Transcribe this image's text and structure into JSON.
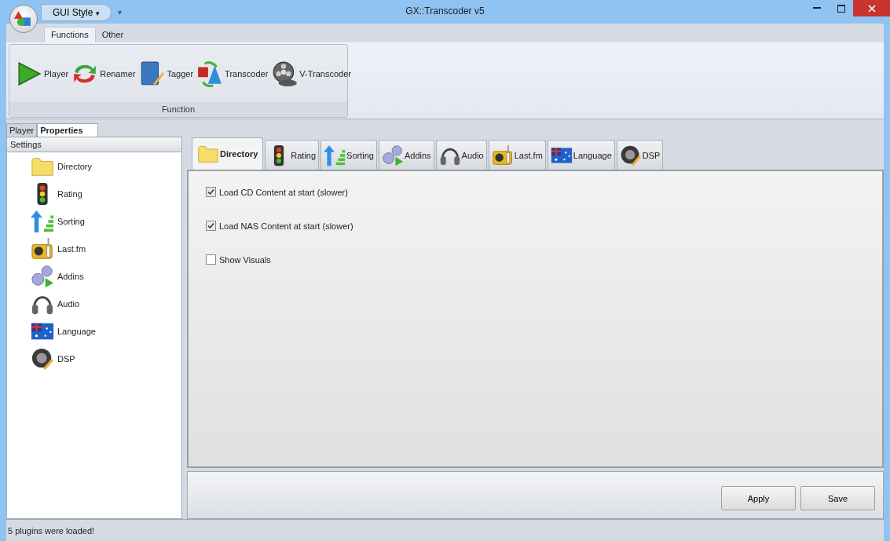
{
  "window": {
    "title": "GX::Transcoder v5",
    "quick_access": "GUI Style",
    "quick_access_caret": "▾",
    "customize_caret": "▾"
  },
  "ribbon": {
    "tabs": [
      {
        "label": "Functions",
        "selected": true
      },
      {
        "label": "Other",
        "selected": false
      }
    ],
    "group": {
      "label": "Function",
      "buttons": [
        "Player",
        "Renamer",
        "Tagger",
        "Transcoder",
        "V-Transcoder"
      ]
    }
  },
  "dock_tabs": [
    {
      "label": "Player",
      "selected": false
    },
    {
      "label": "Properties",
      "selected": true
    }
  ],
  "settings": {
    "header": "Settings",
    "items": [
      "Directory",
      "Rating",
      "Sorting",
      "Last.fm",
      "Addins",
      "Audio",
      "Language",
      "DSP"
    ]
  },
  "page_tabs": [
    {
      "label": "Directory",
      "selected": true
    },
    {
      "label": "Rating",
      "selected": false
    },
    {
      "label": "Sorting",
      "selected": false
    },
    {
      "label": "Addins",
      "selected": false
    },
    {
      "label": "Audio",
      "selected": false
    },
    {
      "label": "Last.fm",
      "selected": false
    },
    {
      "label": "Language",
      "selected": false
    },
    {
      "label": "DSP",
      "selected": false
    }
  ],
  "options": [
    {
      "label": "Load CD Content at start (slower)",
      "checked": true
    },
    {
      "label": "Load NAS Content at start (slower)",
      "checked": true
    },
    {
      "label": "Show Visuals",
      "checked": false
    }
  ],
  "buttons": [
    "Apply",
    "Save"
  ],
  "status_bar": "5 plugins were loaded!"
}
